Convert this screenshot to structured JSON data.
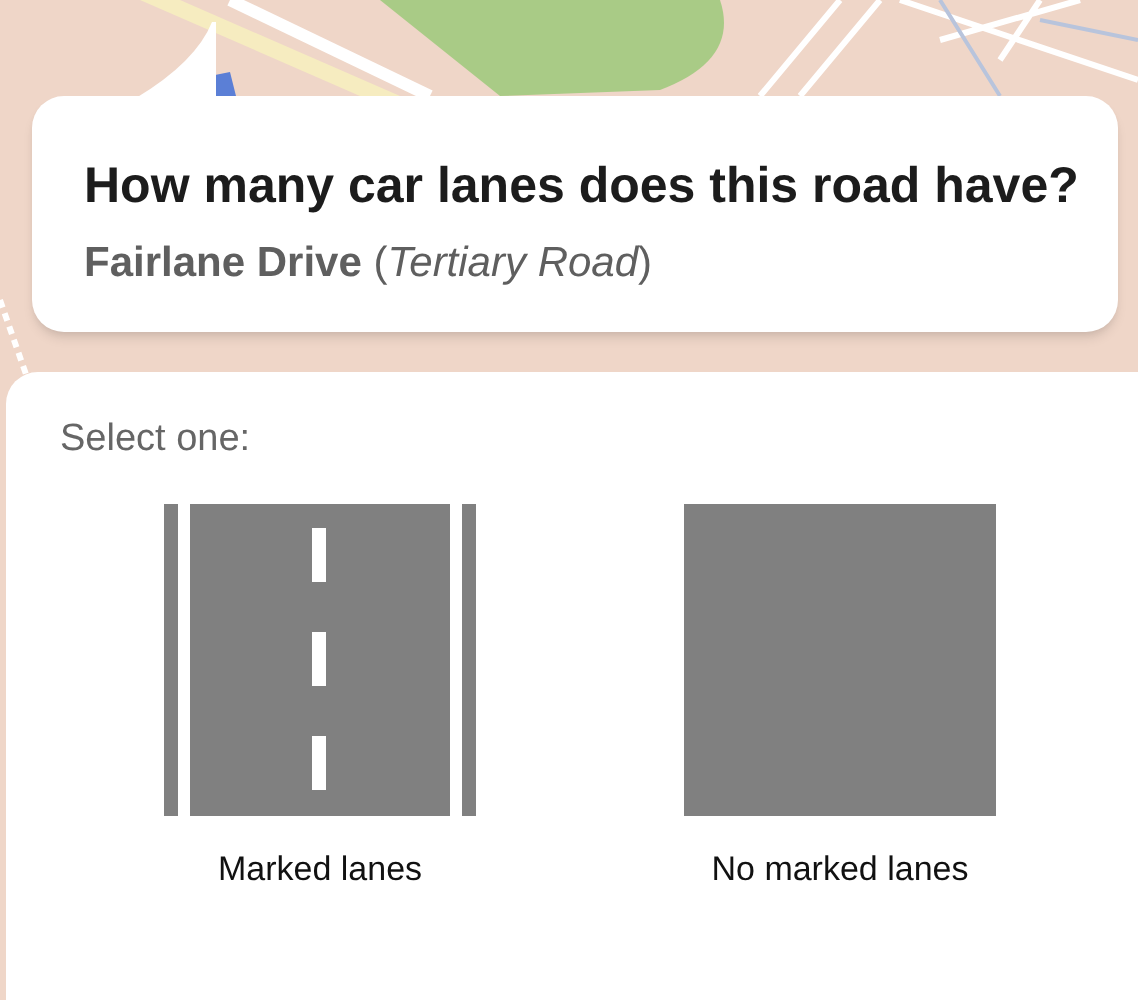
{
  "question": {
    "title": "How many car lanes does this road have?",
    "subtitle": "**Fairlane Drive** (*Tertiary Road*)"
  },
  "answer_sheet": {
    "prompt": "Select one:",
    "options": [
      {
        "kind": "marked",
        "label": "Marked lanes"
      },
      {
        "kind": "unmarked",
        "label": "No marked lanes"
      }
    ]
  }
}
